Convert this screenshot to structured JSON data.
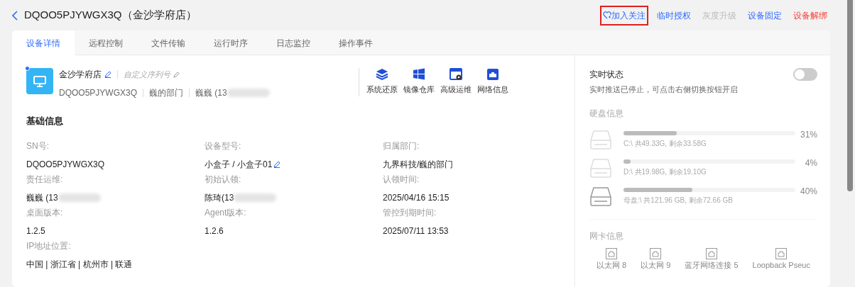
{
  "header": {
    "title": "DQOO5PJYWGX3Q（金沙学府店）"
  },
  "actions": [
    {
      "label": "加入关注",
      "kind": "follow",
      "highlighted": true,
      "disabled": false
    },
    {
      "label": "临时授权",
      "kind": "normal",
      "highlighted": false,
      "disabled": false
    },
    {
      "label": "灰度升级",
      "kind": "normal",
      "highlighted": false,
      "disabled": true
    },
    {
      "label": "设备固定",
      "kind": "normal",
      "highlighted": false,
      "disabled": false
    },
    {
      "label": "设备解绑",
      "kind": "danger",
      "highlighted": false,
      "disabled": false
    }
  ],
  "tabs": [
    {
      "label": "设备详情",
      "selected": true
    },
    {
      "label": "远程控制",
      "selected": false
    },
    {
      "label": "文件传输",
      "selected": false
    },
    {
      "label": "运行时序",
      "selected": false
    },
    {
      "label": "日志监控",
      "selected": false
    },
    {
      "label": "操作事件",
      "selected": false
    }
  ],
  "device": {
    "name": "金沙学府店",
    "custom_serial": "自定义序列号",
    "online": true,
    "meta": [
      {
        "text": "DQOO5PJYWGX3Q",
        "redacted": false
      },
      {
        "text": "巍的部门",
        "redacted": false
      },
      {
        "text": "巍巍 (13",
        "redacted": true
      }
    ]
  },
  "tools": [
    {
      "label": "系统还原",
      "kind": "layers"
    },
    {
      "label": "镜像仓库",
      "kind": "windows"
    },
    {
      "label": "高级运维",
      "kind": "window-gear"
    },
    {
      "label": "网络信息",
      "kind": "network"
    }
  ],
  "basic_info": {
    "title": "基础信息",
    "fields": [
      {
        "label": "SN号:",
        "value": "DQOO5PJYWGX3Q",
        "editable": false,
        "redacted": false
      },
      {
        "label": "设备型号:",
        "value": "小盒子  / 小盒子01",
        "editable": true,
        "redacted": false
      },
      {
        "label": "归属部门:",
        "value": "九界科技/巍的部门",
        "editable": false,
        "redacted": false
      },
      {
        "label": "责任运维:",
        "value": "巍巍 (13",
        "editable": false,
        "redacted": true
      },
      {
        "label": "初始认领:",
        "value": "陈琦(13",
        "editable": false,
        "redacted": true
      },
      {
        "label": "认领时间:",
        "value": "2025/04/16 15:15",
        "editable": false,
        "redacted": false
      },
      {
        "label": "桌面版本:",
        "value": "1.2.5",
        "editable": false,
        "redacted": false
      },
      {
        "label": "Agent版本:",
        "value": "1.2.6",
        "editable": false,
        "redacted": false
      },
      {
        "label": "管控到期时间:",
        "value": "2025/07/11 13:53",
        "editable": false,
        "redacted": false
      },
      {
        "label": "IP地址位置:",
        "value": "中国 | 浙江省 | 杭州市 | 联通",
        "editable": false,
        "redacted": false
      }
    ]
  },
  "realtime": {
    "title": "实时状态",
    "description": "实时推送已停止，可点击右侧切换按钮开启",
    "on": false
  },
  "disks": {
    "title": "硬盘信息",
    "items": [
      {
        "kind": "partition",
        "level": 0.31,
        "percent": "31%",
        "detail": "C:\\ 共49.33G, 剩余33.58G"
      },
      {
        "kind": "partition",
        "level": 0.04,
        "percent": "4%",
        "detail": "D:\\ 共19.98G, 剩余19.10G"
      },
      {
        "kind": "master",
        "level": 0.4,
        "percent": "40%",
        "detail": "母盘:\\ 共121.96 GB, 剩余72.66 GB"
      }
    ]
  },
  "network": {
    "title": "网卡信息",
    "adapters": [
      "以太网 8",
      "以太网 9",
      "蓝牙网络连接 5",
      "Loopback Pseuc"
    ]
  }
}
